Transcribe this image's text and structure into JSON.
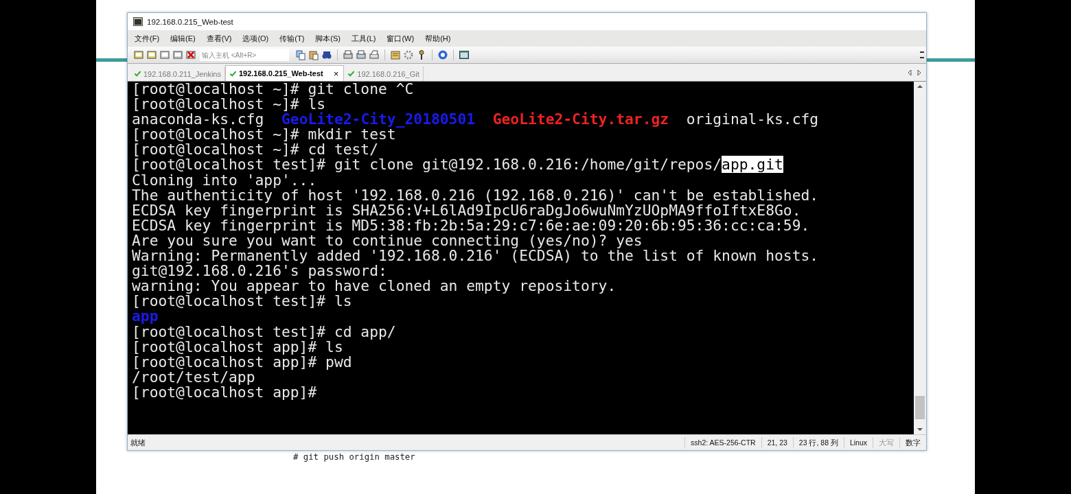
{
  "window": {
    "title": "192.168.0.215_Web-test"
  },
  "menu": [
    "文件(F)",
    "编辑(E)",
    "查看(V)",
    "选项(O)",
    "传输(T)",
    "脚本(S)",
    "工具(L)",
    "窗口(W)",
    "帮助(H)"
  ],
  "toolbar": {
    "host_field": {
      "placeholder": "输入主机 <Alt+R>"
    }
  },
  "tabs": [
    {
      "label": "192.168.0.211_Jenkins",
      "selected": false,
      "connected": true
    },
    {
      "label": "192.168.0.215_Web-test",
      "selected": true,
      "connected": true,
      "close": "×"
    },
    {
      "label": "192.168.0.216_Git",
      "selected": false,
      "connected": true
    }
  ],
  "terminal": {
    "lines": [
      [
        {
          "text": "[root@localhost ~]# git clone ^C",
          "kind": "plain"
        }
      ],
      [
        {
          "text": "[root@localhost ~]# ls",
          "kind": "plain"
        }
      ],
      [
        {
          "text": "anaconda-ks.cfg  ",
          "kind": "plain"
        },
        {
          "text": "GeoLite2-City_20180501  ",
          "kind": "dir"
        },
        {
          "text": "GeoLite2-City.tar.gz",
          "kind": "archive"
        },
        {
          "text": "  original-ks.cfg",
          "kind": "plain"
        }
      ],
      [
        {
          "text": "[root@localhost ~]# mkdir test",
          "kind": "plain"
        }
      ],
      [
        {
          "text": "[root@localhost ~]# cd test/",
          "kind": "plain"
        }
      ],
      [
        {
          "text": "[root@localhost test]# git clone git@192.168.0.216:/home/git/repos/",
          "kind": "plain"
        },
        {
          "text": "app.git",
          "kind": "selection"
        }
      ],
      [
        {
          "text": "Cloning into 'app'...",
          "kind": "plain"
        }
      ],
      [
        {
          "text": "The authenticity of host '192.168.0.216 (192.168.0.216)' can't be established.",
          "kind": "plain"
        }
      ],
      [
        {
          "text": "ECDSA key fingerprint is SHA256:V+L6lAd9IpcU6raDgJo6wuNmYzUOpMA9ffoIftxE8Go.",
          "kind": "plain"
        }
      ],
      [
        {
          "text": "ECDSA key fingerprint is MD5:38:fb:2b:5a:29:c7:6e:ae:09:20:6b:95:36:cc:ca:59.",
          "kind": "plain"
        }
      ],
      [
        {
          "text": "Are you sure you want to continue connecting (yes/no)? yes",
          "kind": "plain"
        }
      ],
      [
        {
          "text": "Warning: Permanently added '192.168.0.216' (ECDSA) to the list of known hosts.",
          "kind": "plain"
        }
      ],
      [
        {
          "text": "git@192.168.0.216's password:",
          "kind": "plain"
        }
      ],
      [
        {
          "text": "warning: You appear to have cloned an empty repository.",
          "kind": "plain"
        }
      ],
      [
        {
          "text": "[root@localhost test]# ls",
          "kind": "plain"
        }
      ],
      [
        {
          "text": "app",
          "kind": "dir"
        }
      ],
      [
        {
          "text": "[root@localhost test]# cd app/",
          "kind": "plain"
        }
      ],
      [
        {
          "text": "[root@localhost app]# ls",
          "kind": "plain"
        }
      ],
      [
        {
          "text": "[root@localhost app]# pwd",
          "kind": "plain"
        }
      ],
      [
        {
          "text": "/root/test/app",
          "kind": "plain"
        }
      ],
      [
        {
          "text": "[root@localhost app]#",
          "kind": "plain"
        }
      ]
    ]
  },
  "status_bar": [
    {
      "text": "就绪",
      "kind": "message",
      "disabled": false
    },
    {
      "text": "ssh2: AES-256-CTR",
      "kind": "cell",
      "disabled": false
    },
    {
      "text": "21,  23",
      "kind": "cell",
      "disabled": false
    },
    {
      "text": "23 行, 88 列",
      "kind": "cell",
      "disabled": false
    },
    {
      "text": "Linux",
      "kind": "cell",
      "disabled": false
    },
    {
      "text": "大写",
      "kind": "cell",
      "disabled": true
    },
    {
      "text": "数字",
      "kind": "cell",
      "disabled": false
    }
  ],
  "background_note": "# git push origin master"
}
